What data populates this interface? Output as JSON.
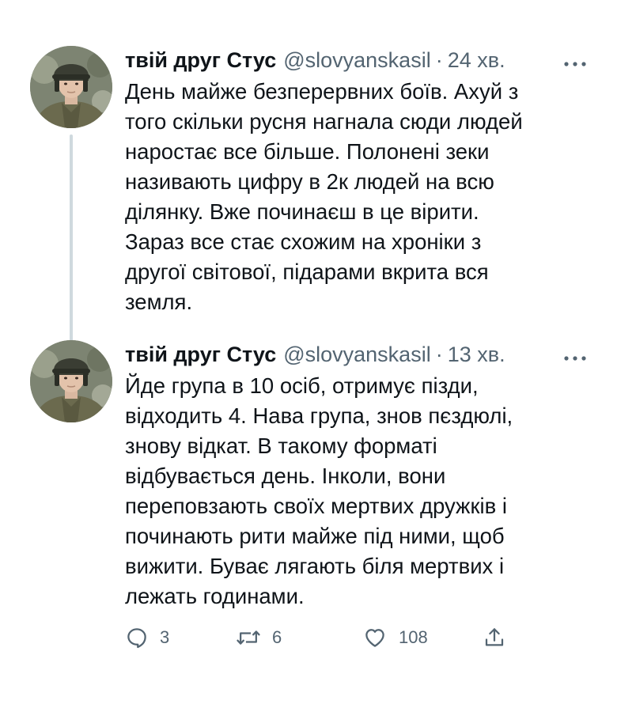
{
  "tweets": [
    {
      "display_name": "твій друг Стус",
      "handle": "@slovyanskasil",
      "separator": "·",
      "time": "24 хв.",
      "more_icon": "more-horizontal-icon",
      "text_lines": [
        "День майже безперервних боїв. Ахуй з",
        "того скільки русня нагнала сюди людей",
        "наростає все більше. Полонені зеки",
        "називають цифру в 2к людей на всю",
        "ділянку. Вже починаєш в це вірити.",
        "Зараз все стає схожим на хроніки з",
        "другої світової, підарами вкрита вся",
        "земля."
      ]
    },
    {
      "display_name": "твій друг Стус",
      "handle": "@slovyanskasil",
      "separator": "·",
      "time": "13 хв.",
      "more_icon": "more-horizontal-icon",
      "text_lines": [
        "Йде група в 10 осіб, отримує пізди,",
        "відходить 4. Нава група, знов пєздюлі,",
        "знову відкат. В такому форматі",
        "відбувається день. Інколи, вони",
        "переповзають своїх мертвих дружків і",
        "починають рити майже під ними, щоб",
        "вижити. Буває лягають біля мертвих і",
        "лежать годинами."
      ]
    }
  ],
  "actions": {
    "reply": {
      "icon": "reply-icon",
      "count": "3"
    },
    "retweet": {
      "icon": "retweet-icon",
      "count": "6"
    },
    "like": {
      "icon": "heart-icon",
      "count": "108"
    },
    "share": {
      "icon": "share-icon"
    }
  },
  "colors": {
    "text": "#0f1419",
    "secondary": "#536471",
    "thread_line": "#cfd9de",
    "background": "#ffffff"
  }
}
